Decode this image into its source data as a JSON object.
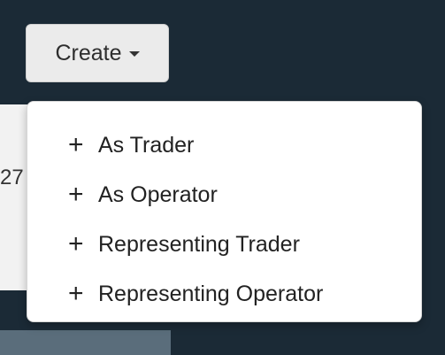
{
  "background": {
    "panel_text": "27"
  },
  "create_button": {
    "label": "Create"
  },
  "menu": {
    "items": [
      {
        "icon": "plus-icon",
        "label": "As Trader"
      },
      {
        "icon": "plus-icon",
        "label": "As Operator"
      },
      {
        "icon": "plus-icon",
        "label": "Representing Trader"
      },
      {
        "icon": "plus-icon",
        "label": "Representing Operator"
      }
    ]
  },
  "colors": {
    "background": "#1b2a36",
    "button_bg": "#ebebeb",
    "menu_bg": "#ffffff",
    "text": "#222222"
  }
}
